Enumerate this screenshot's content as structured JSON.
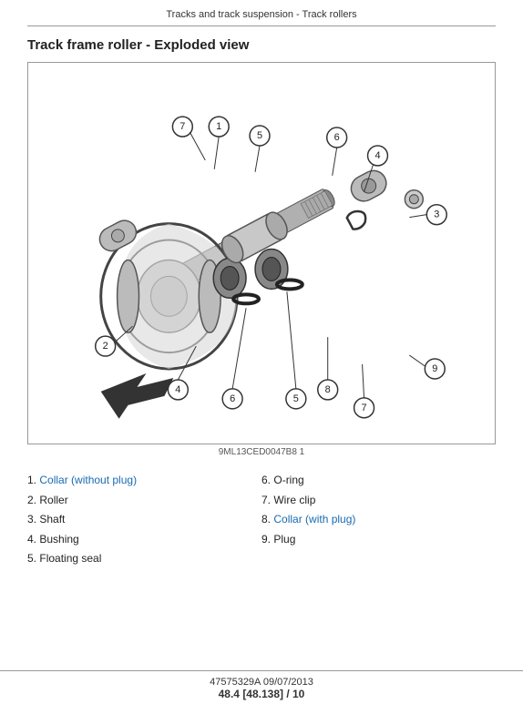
{
  "header": {
    "title": "Tracks and track suspension - Track rollers"
  },
  "section": {
    "title": "Track frame roller - Exploded view"
  },
  "diagram": {
    "label": "9ML13CED0047B8   1"
  },
  "parts": {
    "col1": [
      {
        "num": "1.",
        "name": "Collar (without plug)",
        "highlight": true
      },
      {
        "num": "2.",
        "name": "Roller",
        "highlight": false
      },
      {
        "num": "3.",
        "name": "Shaft",
        "highlight": false
      },
      {
        "num": "4.",
        "name": "Bushing",
        "highlight": false
      },
      {
        "num": "5.",
        "name": "Floating seal",
        "highlight": false
      }
    ],
    "col2": [
      {
        "num": "6.",
        "name": "O-ring",
        "highlight": false
      },
      {
        "num": "7.",
        "name": "Wire clip",
        "highlight": false
      },
      {
        "num": "8.",
        "name": "Collar (with plug)",
        "highlight": true
      },
      {
        "num": "9.",
        "name": "Plug",
        "highlight": false
      }
    ]
  },
  "footer": {
    "doc_num": "47575329A 09/07/2013",
    "page": "48.4 [48.138] / 10"
  }
}
